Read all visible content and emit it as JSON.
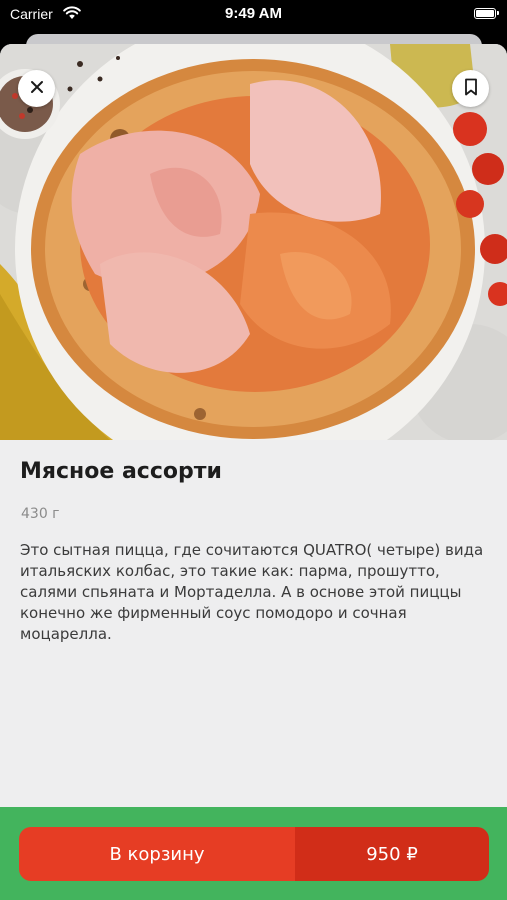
{
  "status_bar": {
    "carrier": "Carrier",
    "time": "9:49 AM"
  },
  "product": {
    "title": "Мясное ассорти",
    "weight": "430 г",
    "description": "Это сытная пицца, где сочитаются QUATRO( четыре) вида итальяских колбас, это такие как: парма, прошутто, салями спьяната и Мортаделла. А в основе этой  пиццы конечно же фирменный соус помодоро и сочная моцарелла.",
    "image_icon": "pizza-photo"
  },
  "actions": {
    "close_icon": "close-icon",
    "bookmark_icon": "bookmark-icon",
    "cart_label": "В корзину",
    "price": "950 ₽"
  },
  "colors": {
    "cart_button": "#e63d24",
    "price_segment": "#d12d18",
    "bottom_bar": "#43b45d",
    "sheet_background": "#eeeeef"
  }
}
